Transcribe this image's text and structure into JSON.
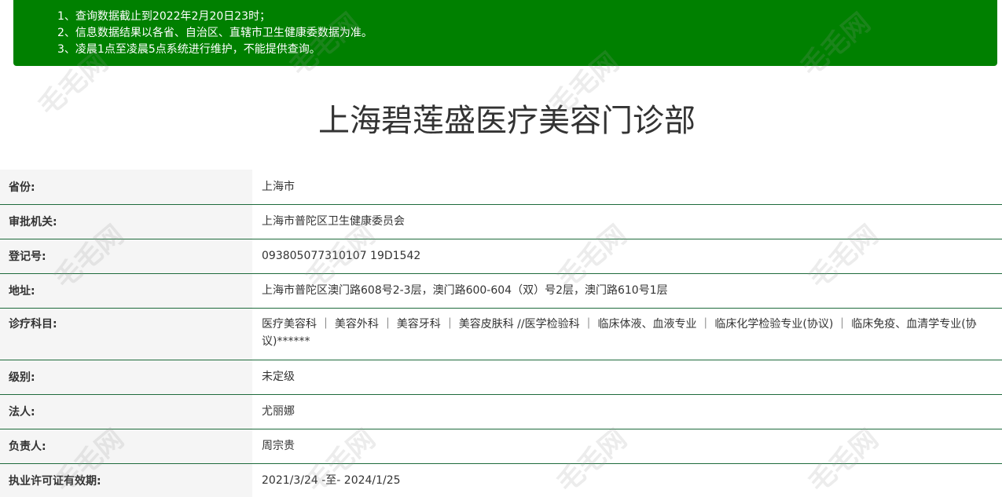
{
  "notice": {
    "lines": [
      "1、查询数据截止到2022年2月20日23时；",
      "2、信息数据结果以各省、自治区、直辖市卫生健康委数据为准。",
      "3、凌晨1点至凌晨5点系统进行维护，不能提供查询。"
    ]
  },
  "title": "上海碧莲盛医疗美容门诊部",
  "rows": [
    {
      "label": "省份:",
      "value": "上海市"
    },
    {
      "label": "审批机关:",
      "value": "上海市普陀区卫生健康委员会"
    },
    {
      "label": "登记号:",
      "value": "093805077310107 19D1542"
    },
    {
      "label": "地址:",
      "value": "上海市普陀区澳门路608号2-3层，澳门路600-604（双）号2层，澳门路610号1层"
    },
    {
      "label": "诊疗科目:",
      "value": "医疗美容科 ｜ 美容外科 ｜ 美容牙科 ｜ 美容皮肤科 //医学检验科 ｜ 临床体液、血液专业 ｜ 临床化学检验专业(协议) ｜ 临床免疫、血清学专业(协议)******"
    },
    {
      "label": "级别:",
      "value": "未定级"
    },
    {
      "label": "法人:",
      "value": "尤丽娜"
    },
    {
      "label": "负责人:",
      "value": "周宗贵"
    },
    {
      "label": "执业许可证有效期:",
      "value": "2021/3/24 -至- 2024/1/25"
    }
  ],
  "watermark": "毛毛网"
}
